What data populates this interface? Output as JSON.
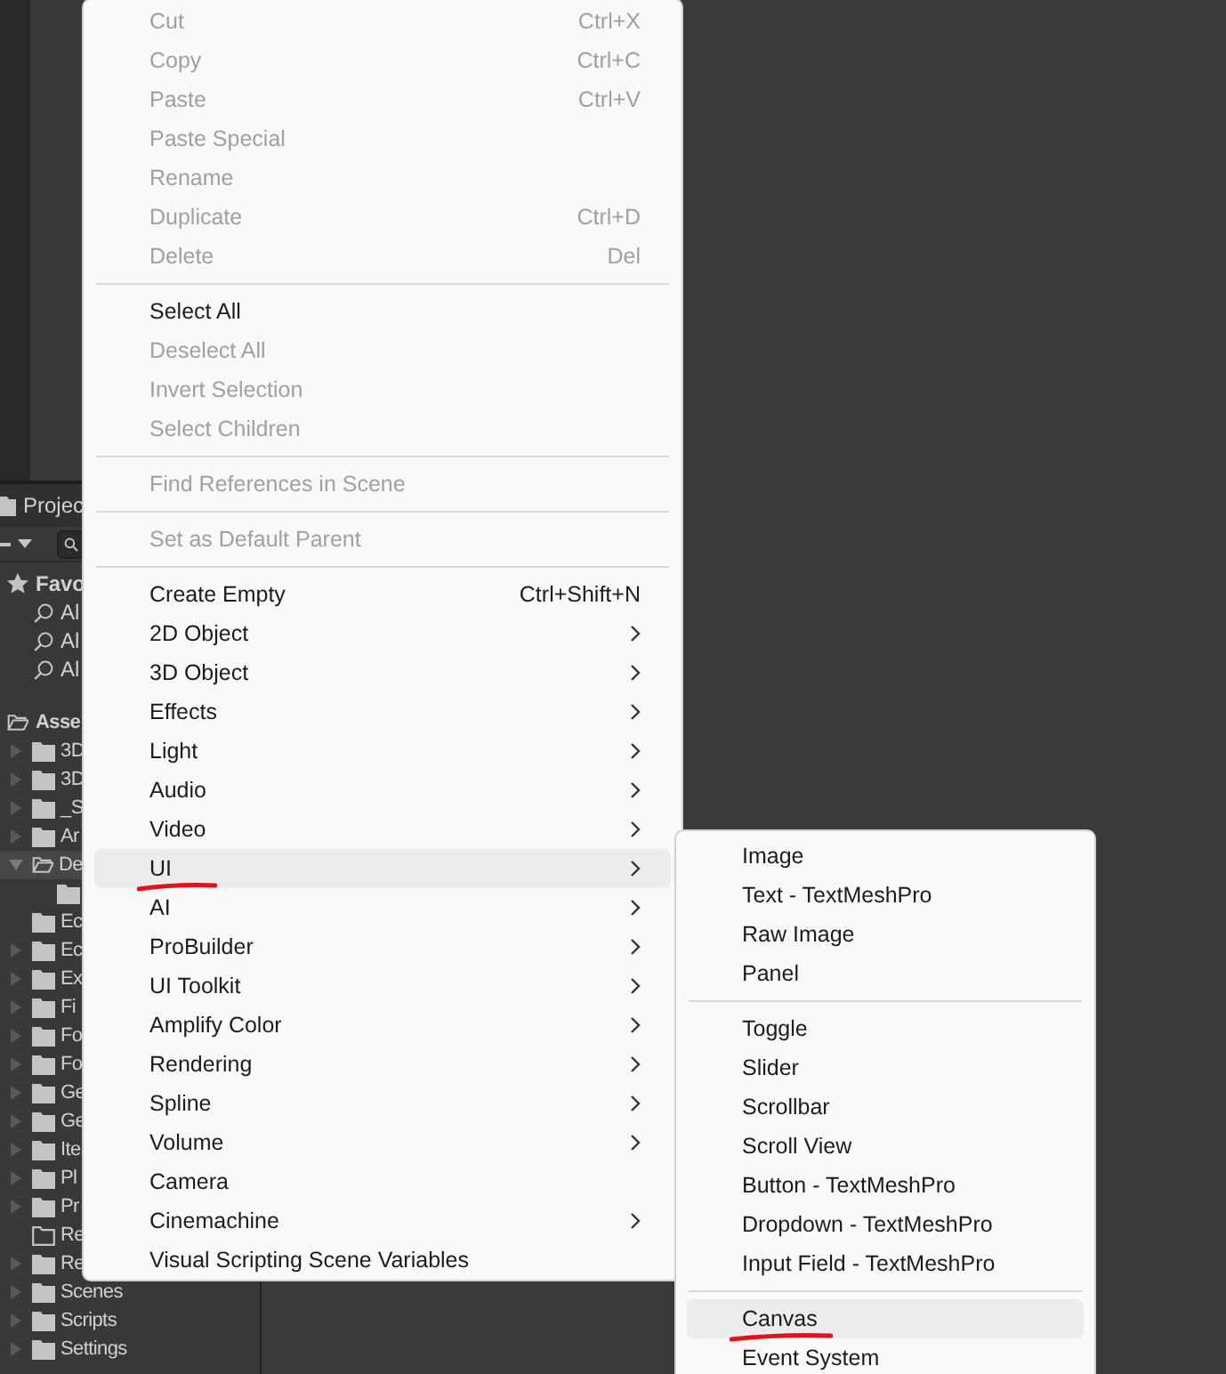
{
  "project_panel": {
    "title": "Projec",
    "favorites": {
      "label": "Favo",
      "items": [
        {
          "label": "Al"
        },
        {
          "label": "Al"
        },
        {
          "label": "Al"
        }
      ]
    },
    "assets": {
      "label": "Asse",
      "expanded": true,
      "children": [
        {
          "label": "3D",
          "expandable": true,
          "expanded": false,
          "selected": false,
          "empty": false
        },
        {
          "label": "3D",
          "expandable": true,
          "expanded": false,
          "selected": false,
          "empty": false
        },
        {
          "label": "_S",
          "expandable": true,
          "expanded": false,
          "selected": false,
          "empty": false
        },
        {
          "label": "Ar",
          "expandable": true,
          "expanded": false,
          "selected": false,
          "empty": false
        },
        {
          "label": "De",
          "expandable": true,
          "expanded": true,
          "selected": true,
          "empty": false,
          "children": [
            {
              "expandable": false,
              "expanded": false,
              "selected": false,
              "empty": false
            }
          ]
        },
        {
          "label": "Ec",
          "expandable": false,
          "expanded": false,
          "selected": false,
          "empty": false
        },
        {
          "label": "Ec",
          "expandable": true,
          "expanded": false,
          "selected": false,
          "empty": false
        },
        {
          "label": "Ex",
          "expandable": true,
          "expanded": false,
          "selected": false,
          "empty": false
        },
        {
          "label": "Fi",
          "expandable": true,
          "expanded": false,
          "selected": false,
          "empty": false
        },
        {
          "label": "Fo",
          "expandable": true,
          "expanded": false,
          "selected": false,
          "empty": false
        },
        {
          "label": "Fo",
          "expandable": true,
          "expanded": false,
          "selected": false,
          "empty": false
        },
        {
          "label": "Ge",
          "expandable": true,
          "expanded": false,
          "selected": false,
          "empty": false
        },
        {
          "label": "Ge",
          "expandable": true,
          "expanded": false,
          "selected": false,
          "empty": false
        },
        {
          "label": "Ite",
          "expandable": true,
          "expanded": false,
          "selected": false,
          "empty": false
        },
        {
          "label": "Pl",
          "expandable": true,
          "expanded": false,
          "selected": false,
          "empty": false
        },
        {
          "label": "Pr",
          "expandable": true,
          "expanded": false,
          "selected": false,
          "empty": false
        },
        {
          "label": "Re",
          "expandable": false,
          "expanded": false,
          "selected": false,
          "empty": true
        },
        {
          "label": "Re",
          "expandable": true,
          "expanded": false,
          "selected": false,
          "empty": false
        },
        {
          "label": "Scenes",
          "expandable": true,
          "expanded": false,
          "selected": false,
          "empty": false
        },
        {
          "label": "Scripts",
          "expandable": true,
          "expanded": false,
          "selected": false,
          "empty": false
        },
        {
          "label": "Settings",
          "expandable": true,
          "expanded": false,
          "selected": false,
          "empty": false
        }
      ]
    }
  },
  "context_menu": {
    "groups": [
      [
        {
          "label": "Cut",
          "shortcut": "Ctrl+X",
          "disabled": true
        },
        {
          "label": "Copy",
          "shortcut": "Ctrl+C",
          "disabled": true
        },
        {
          "label": "Paste",
          "shortcut": "Ctrl+V",
          "disabled": true
        },
        {
          "label": "Paste Special",
          "disabled": true
        },
        {
          "label": "Rename",
          "disabled": true
        },
        {
          "label": "Duplicate",
          "shortcut": "Ctrl+D",
          "disabled": true
        },
        {
          "label": "Delete",
          "shortcut": "Del",
          "disabled": true
        }
      ],
      [
        {
          "label": "Select All",
          "disabled": false
        },
        {
          "label": "Deselect All",
          "disabled": true
        },
        {
          "label": "Invert Selection",
          "disabled": true
        },
        {
          "label": "Select Children",
          "disabled": true
        }
      ],
      [
        {
          "label": "Find References in Scene",
          "disabled": true
        }
      ],
      [
        {
          "label": "Set as Default Parent",
          "disabled": true
        }
      ],
      [
        {
          "label": "Create Empty",
          "shortcut": "Ctrl+Shift+N",
          "disabled": false
        },
        {
          "label": "2D Object",
          "submenu": true,
          "disabled": false
        },
        {
          "label": "3D Object",
          "submenu": true,
          "disabled": false
        },
        {
          "label": "Effects",
          "submenu": true,
          "disabled": false
        },
        {
          "label": "Light",
          "submenu": true,
          "disabled": false
        },
        {
          "label": "Audio",
          "submenu": true,
          "disabled": false
        },
        {
          "label": "Video",
          "submenu": true,
          "disabled": false
        },
        {
          "label": "UI",
          "submenu": true,
          "disabled": false,
          "selected": true,
          "underlined": true
        },
        {
          "label": "AI",
          "submenu": true,
          "disabled": false
        },
        {
          "label": "ProBuilder",
          "submenu": true,
          "disabled": false
        },
        {
          "label": "UI Toolkit",
          "submenu": true,
          "disabled": false
        },
        {
          "label": "Amplify Color",
          "submenu": true,
          "disabled": false
        },
        {
          "label": "Rendering",
          "submenu": true,
          "disabled": false
        },
        {
          "label": "Spline",
          "submenu": true,
          "disabled": false
        },
        {
          "label": "Volume",
          "submenu": true,
          "disabled": false
        },
        {
          "label": "Camera",
          "disabled": false
        },
        {
          "label": "Cinemachine",
          "submenu": true,
          "disabled": false
        },
        {
          "label": "Visual Scripting Scene Variables",
          "disabled": false
        }
      ]
    ]
  },
  "ui_submenu": {
    "groups": [
      [
        {
          "label": "Image"
        },
        {
          "label": "Text - TextMeshPro"
        },
        {
          "label": "Raw Image"
        },
        {
          "label": "Panel"
        }
      ],
      [
        {
          "label": "Toggle"
        },
        {
          "label": "Slider"
        },
        {
          "label": "Scrollbar"
        },
        {
          "label": "Scroll View"
        },
        {
          "label": "Button - TextMeshPro"
        },
        {
          "label": "Dropdown - TextMeshPro"
        },
        {
          "label": "Input Field - TextMeshPro"
        }
      ],
      [
        {
          "label": "Canvas",
          "selected": true,
          "underlined": true
        },
        {
          "label": "Event System"
        }
      ]
    ]
  }
}
